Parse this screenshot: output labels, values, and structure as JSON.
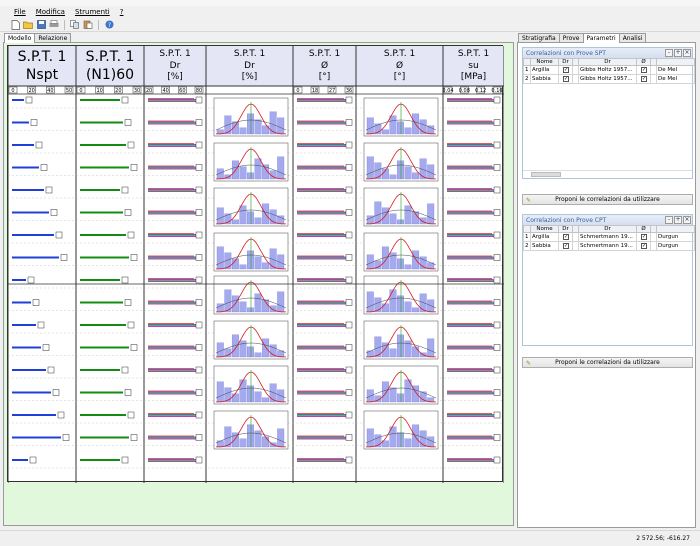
{
  "menu": {
    "file": "File",
    "modifica": "Modifica",
    "strumenti": "Strumenti",
    "help": "?"
  },
  "toolbar": {
    "icons": [
      "new-icon",
      "open-icon",
      "save-icon",
      "print-icon",
      "copy-icon",
      "paste-icon",
      "help-icon"
    ]
  },
  "left_tabs": {
    "modello": "Modello",
    "relazione": "Relazione"
  },
  "right_tabs": {
    "stratigrafia": "Stratigrafia",
    "prove": "Prove",
    "parametri": "Parametri",
    "analisi": "Analisi"
  },
  "columns": [
    {
      "line1": "S.P.T. 1",
      "line2": "Nspt",
      "line3": "",
      "ticks": [
        "0",
        "20",
        "40",
        "50"
      ]
    },
    {
      "line1": "S.P.T. 1",
      "line2": "(N1)60",
      "line3": "",
      "ticks": [
        "0",
        "10",
        "20",
        "30"
      ]
    },
    {
      "line1": "S.P.T. 1",
      "line2": "Dr",
      "line3": "[%]",
      "ticks": [
        "20",
        "40",
        "60",
        "80"
      ]
    },
    {
      "line1": "S.P.T. 1",
      "line2": "Dr",
      "line3": "[%]",
      "ticks": []
    },
    {
      "line1": "S.P.T. 1",
      "line2": "Ø",
      "line3": "[°]",
      "ticks": [
        "0",
        "18",
        "27",
        "36"
      ]
    },
    {
      "line1": "S.P.T. 1",
      "line2": "Ø",
      "line3": "[°]",
      "ticks": []
    },
    {
      "line1": "S.P.T. 1",
      "line2": "su",
      "line3": "[MPa]",
      "ticks": [
        "0.04",
        "0.08",
        "0.12",
        "0.16"
      ]
    }
  ],
  "spt_correlations": {
    "title": "Correlazioni con Prove SPT",
    "headers": [
      "",
      "Nome",
      "Dr",
      "",
      "Dr",
      "Ø",
      "",
      ""
    ],
    "rows": [
      {
        "n": "1",
        "nome": "Argilla",
        "dr": "Gibbs Holtz 1957...",
        "phi": "De Mel"
      },
      {
        "n": "2",
        "nome": "Sabbia",
        "dr": "Gibbs Holtz 1957...",
        "phi": "De Mel"
      }
    ],
    "button": "Proponi le correlazioni da utilizzare"
  },
  "cpt_correlations": {
    "title": "Correlazioni con Prove CPT",
    "headers": [
      "",
      "Nome",
      "Dr",
      "",
      "Dr",
      "Ø",
      "",
      ""
    ],
    "rows": [
      {
        "n": "1",
        "nome": "Argilla",
        "dr": "Schmertmann 19...",
        "phi": "Durgun"
      },
      {
        "n": "2",
        "nome": "Sabbia",
        "dr": "Schmertmann 19...",
        "phi": "Durgun"
      }
    ],
    "button": "Proponi le correlazioni da utilizzare"
  },
  "status": {
    "coords": "2 572.56; -616.27"
  }
}
